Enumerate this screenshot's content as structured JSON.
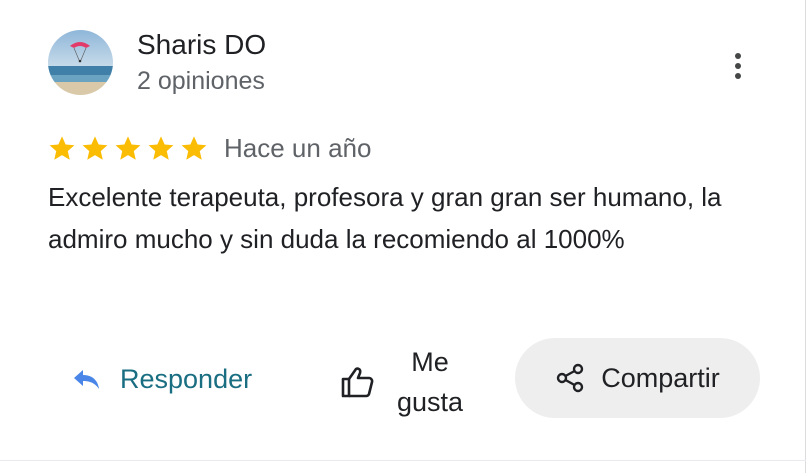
{
  "review": {
    "author_name": "Sharis DO",
    "author_reviews": "2 opiniones",
    "rating": 5,
    "rating_max": 5,
    "date": "Hace un año",
    "text": "Excelente terapeuta, profesora y gran gran ser humano, la admiro mucho y sin duda la recomiendo al 1000%"
  },
  "actions": {
    "reply_label": "Responder",
    "like_label": "Me gusta",
    "share_label": "Compartir"
  },
  "icons": {
    "menu": "more-vert-icon",
    "reply": "reply-icon",
    "like": "thumb-up-icon",
    "share": "share-icon",
    "star": "star-icon"
  },
  "colors": {
    "star": "#fbbc04",
    "reply_text": "#1a6e82",
    "reply_icon": "#4a86e8",
    "share_bg": "#eeeeee"
  }
}
